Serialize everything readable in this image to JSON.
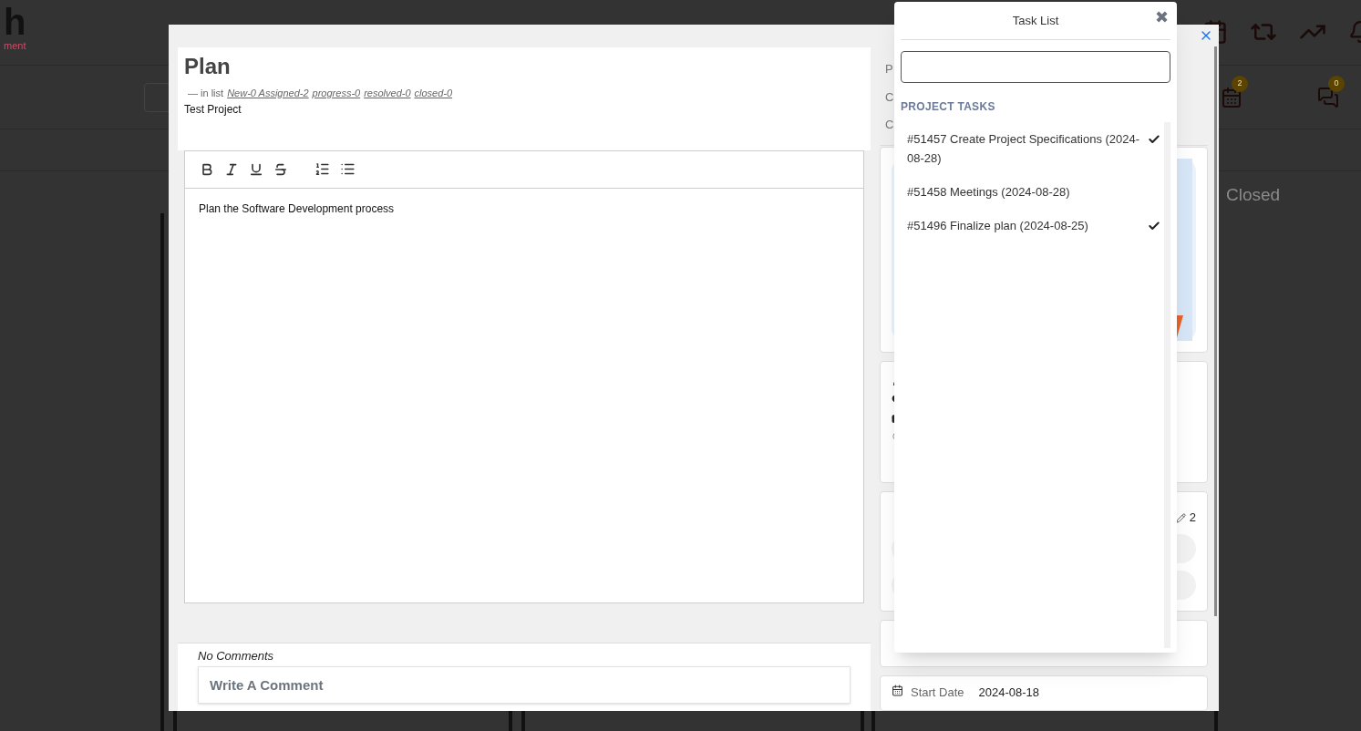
{
  "background": {
    "logo_letter": "h",
    "logo_tagline": "ment",
    "badges": [
      {
        "count": "2"
      },
      {
        "count": "0"
      }
    ],
    "column_title": "Closed"
  },
  "modal": {
    "title": "Plan",
    "list_prefix": "— in list",
    "statuses": [
      "New-0 Assigned-2",
      "progress-0",
      "resolved-0",
      "closed-0"
    ],
    "project": "Test Project",
    "editor": {
      "content": "Plan the Software Development process"
    },
    "comments": {
      "empty_text": "No Comments",
      "placeholder": "Write A Comment"
    },
    "side_labels": [
      "P",
      "C",
      "C"
    ],
    "subtask_count": "2",
    "start_date": {
      "label": "Start Date",
      "value": "2024-08-18"
    }
  },
  "task_list": {
    "title": "Task List",
    "close": "✖",
    "section": "PROJECT TASKS",
    "tasks": [
      {
        "label": "#51457 Create Project Specifications (2024-08-28)",
        "checked": true
      },
      {
        "label": "#51458 Meetings (2024-08-28)",
        "checked": false
      },
      {
        "label": "#51496 Finalize plan (2024-08-25)",
        "checked": true
      }
    ]
  }
}
